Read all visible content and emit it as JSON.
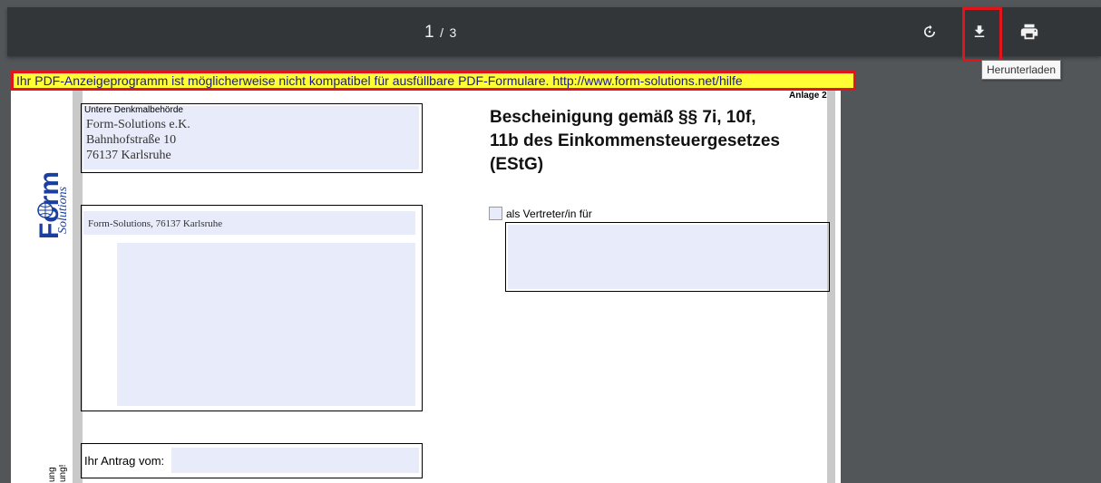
{
  "toolbar": {
    "page_current": "1",
    "page_separator": "/",
    "page_total": "3",
    "rotate_icon": "rotate-icon",
    "download_icon": "download-icon",
    "print_icon": "print-icon",
    "download_tooltip": "Herunterladen",
    "highlight_color": "#e0151b"
  },
  "warning": {
    "text": "Ihr PDF-Anzeigeprogramm ist möglicherweise nicht kompatibel für ausfüllbare PDF-Formulare. http://www.form-solutions.net/hilfe",
    "background": "#ffff33"
  },
  "document": {
    "anlage": "Anlage 2",
    "authority_label": "Untere Denkmalbehörde",
    "authority_lines": [
      "Form-Solutions e.K.",
      "Bahnhofstraße 10",
      "76137 Karlsruhe"
    ],
    "sender_line": "Form-Solutions, 76137 Karlsruhe",
    "heading_lines": [
      "Bescheinigung gemäß §§ 7i, 10f,",
      "11b des Einkommensteuergesetzes",
      "(EStG)"
    ],
    "representative_label": "als Vertreter/in für",
    "application_label": "Ihr Antrag vom:",
    "side_text_1": "ung",
    "side_text_2": "ung!",
    "logo_text": "Form",
    "logo_subtext": "Solutions",
    "field_color": "#e8ebfa"
  }
}
